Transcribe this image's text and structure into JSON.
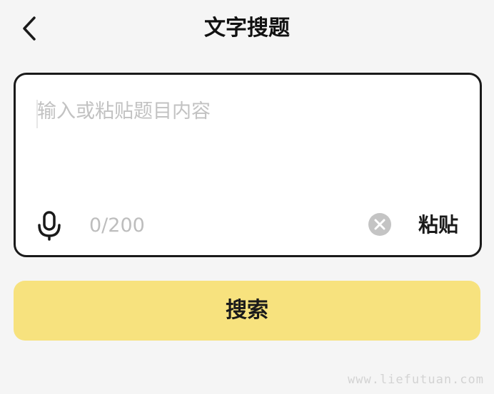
{
  "header": {
    "title": "文字搜题",
    "back_icon": "chevron-left-icon"
  },
  "input": {
    "placeholder": "输入或粘贴题目内容",
    "value": "",
    "counter": "0/200",
    "mic_icon": "microphone-icon",
    "clear_icon": "clear-circle-icon",
    "paste_label": "粘贴"
  },
  "actions": {
    "search_label": "搜索"
  },
  "watermark": "www.liefutuan.com",
  "colors": {
    "background": "#f5f5f5",
    "accent": "#f7e27e",
    "border": "#1a1a1a",
    "placeholder": "#c2c2c2"
  }
}
